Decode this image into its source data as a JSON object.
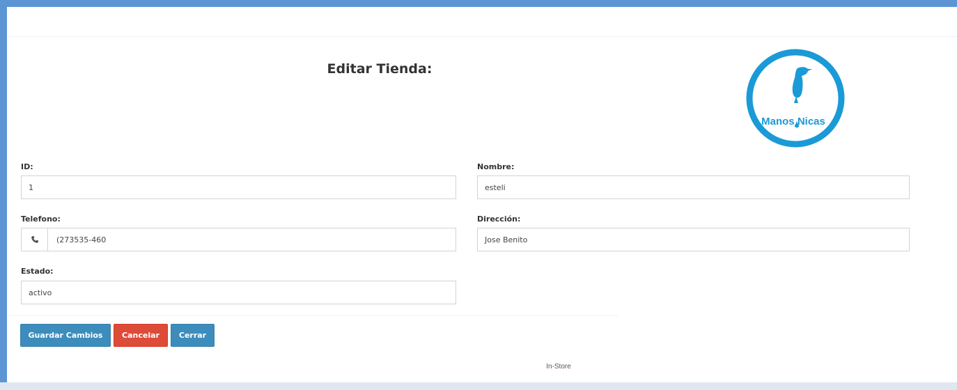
{
  "page": {
    "title": "Editar Tienda:"
  },
  "logo": {
    "text": "Manos Nicas",
    "color": "#1a9ad6"
  },
  "form": {
    "id": {
      "label": "ID:",
      "value": "1"
    },
    "nombre": {
      "label": "Nombre:",
      "value": "esteli"
    },
    "telefono": {
      "label": "Telefono:",
      "value": "(273535-460",
      "icon": "phone-icon"
    },
    "direccion": {
      "label": "Dirección:",
      "value": "Jose Benito"
    },
    "estado": {
      "label": "Estado:",
      "value": "activo"
    }
  },
  "buttons": {
    "save": "Guardar Cambios",
    "cancel": "Cancelar",
    "close": "Cerrar"
  },
  "footer": {
    "text": "In-Store"
  },
  "colors": {
    "frame": "#5b95d4",
    "primary": "#3c8dbc",
    "danger": "#dd4b39"
  }
}
